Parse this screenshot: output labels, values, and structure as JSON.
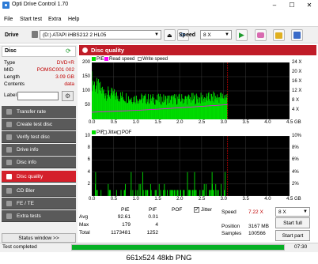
{
  "window": {
    "title": "Opti Drive Control 1.70"
  },
  "menu": [
    "File",
    "Start test",
    "Extra",
    "Help"
  ],
  "drivebar": {
    "drive_label": "Drive",
    "drive_value": "(D:)   ATAPI iHBS212  2 HL05",
    "speed_label": "Speed",
    "speed_value": "8 X"
  },
  "disc": {
    "header": "Disc",
    "rows": [
      {
        "k": "Type",
        "v": "DVD+R"
      },
      {
        "k": "MID",
        "v": "POMSC001 002"
      },
      {
        "k": "Length",
        "v": "3.09 GB"
      },
      {
        "k": "Contents",
        "v": "data"
      }
    ],
    "label_caption": "Label"
  },
  "nav": [
    {
      "label": "Transfer rate",
      "active": false
    },
    {
      "label": "Create test disc",
      "active": false
    },
    {
      "label": "Verify test disc",
      "active": false
    },
    {
      "label": "Drive info",
      "active": false
    },
    {
      "label": "Disc info",
      "active": false
    },
    {
      "label": "Disc quality",
      "active": true
    },
    {
      "label": "CD Bler",
      "active": false
    },
    {
      "label": "FE / TE",
      "active": false
    },
    {
      "label": "Extra tests",
      "active": false
    }
  ],
  "status_window_btn": "Status window >>",
  "quality": {
    "title": "Disc quality",
    "legend1": [
      "PIE",
      "Read speed",
      "Write speed"
    ],
    "legend2": [
      "PIF",
      "Jitter",
      "POF"
    ]
  },
  "chart_data": [
    {
      "type": "area",
      "series": [
        {
          "name": "PIE",
          "color": "#00e000"
        },
        {
          "name": "Read speed",
          "color": "#ff00ff"
        },
        {
          "name": "Write speed",
          "color": "#ffffff"
        }
      ],
      "x_ticks": [
        "0.0",
        "0.5",
        "1.0",
        "1.5",
        "2.0",
        "2.5",
        "3.0",
        "3.5",
        "4.0",
        "4.5 GB"
      ],
      "y_left_ticks": [
        "200",
        "150",
        "100",
        "50"
      ],
      "y_right_ticks": [
        "24 X",
        "20 X",
        "16 X",
        "12 X",
        "8 X",
        "4 X"
      ],
      "xlim": [
        0,
        4.5
      ],
      "ylim": [
        0,
        200
      ],
      "pie_profile_x": [
        0.0,
        0.1,
        0.3,
        0.6,
        1.0,
        1.5,
        2.0,
        2.5,
        2.9,
        3.09
      ],
      "pie_profile_y": [
        175,
        150,
        120,
        105,
        95,
        90,
        92,
        95,
        100,
        105
      ],
      "speed_profile_x": [
        0.0,
        0.5,
        1.0,
        1.5,
        2.0,
        2.5,
        3.09
      ],
      "speed_profile_y": [
        3.0,
        3.4,
        3.8,
        4.3,
        4.9,
        5.5,
        6.2
      ],
      "end_marker": 3.09
    },
    {
      "type": "bar",
      "series": [
        {
          "name": "PIF",
          "color": "#00e000"
        },
        {
          "name": "Jitter",
          "color": "#ffffff"
        },
        {
          "name": "POF",
          "color": "#ffffff"
        }
      ],
      "x_ticks": [
        "0.0",
        "0.5",
        "1.0",
        "1.5",
        "2.0",
        "2.5",
        "3.0",
        "3.5",
        "4.0",
        "4.5 GB"
      ],
      "y_left_ticks": [
        "10",
        "8",
        "6",
        "4",
        "2"
      ],
      "y_right_ticks": [
        "10%",
        "8%",
        "6%",
        "4%",
        "2%"
      ],
      "xlim": [
        0,
        4.5
      ],
      "ylim": [
        0,
        10
      ],
      "end_marker": 3.09
    }
  ],
  "stats": {
    "headers": [
      "PIE",
      "PIF",
      "POF"
    ],
    "jitter_label": "Jitter",
    "rows": [
      {
        "k": "Avg",
        "pie": "92.61",
        "pif": "0.01"
      },
      {
        "k": "Max",
        "pie": "179",
        "pif": "4"
      },
      {
        "k": "Total",
        "pie": "1173481",
        "pif": "1252"
      }
    ],
    "speed_label": "Speed",
    "speed_value": "7.22 X",
    "position_label": "Position",
    "position_value": "3167 MB",
    "samples_label": "Samples",
    "samples_value": "100566",
    "speed_select": "8 X",
    "start_full": "Start full",
    "start_part": "Start part"
  },
  "statusbar": {
    "text": "Test completed",
    "progress": 1.0,
    "time": "07:30"
  },
  "caption": "661x524 48kb PNG"
}
